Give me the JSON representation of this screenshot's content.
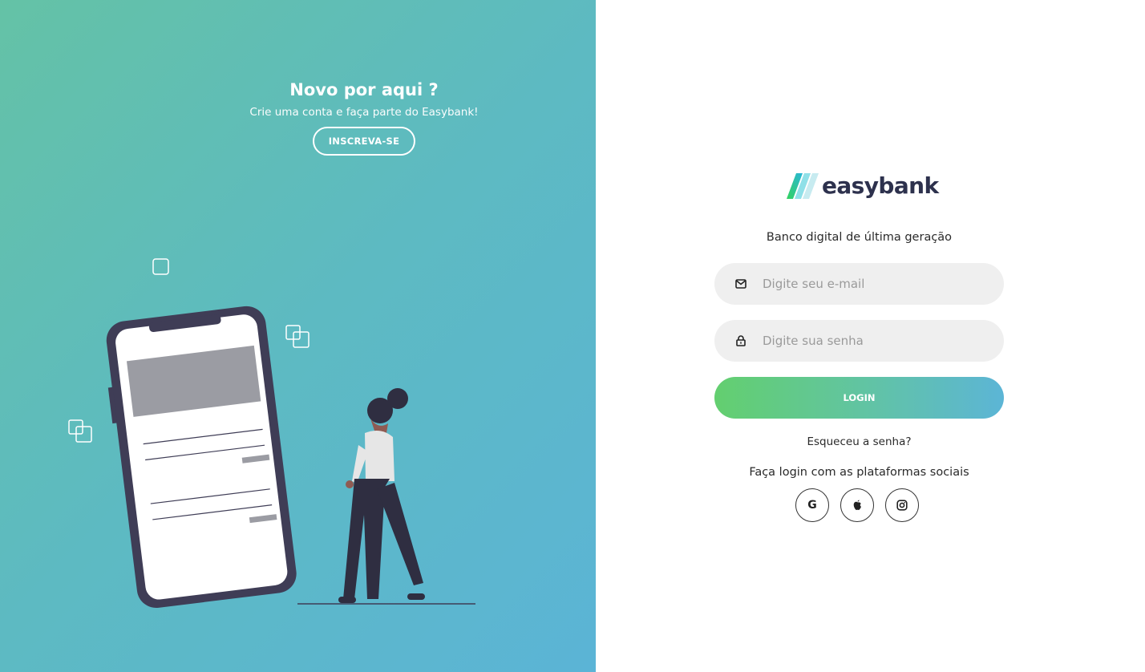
{
  "signup": {
    "title": "Novo por aqui ?",
    "subtitle": "Crie uma conta e faça parte do Easybank!",
    "button_label": "INSCREVA-SE"
  },
  "brand": {
    "name": "easybank",
    "tagline": "Banco digital de última geração"
  },
  "login_form": {
    "email_placeholder": "Digite seu e-mail",
    "email_icon": "envelope-icon",
    "password_placeholder": "Digite sua senha",
    "password_icon": "lock-icon",
    "login_label": "LOGIN",
    "forgot_label": "Esqueceu a senha?"
  },
  "social": {
    "label": "Faça login com as plataformas sociais",
    "providers": [
      {
        "name": "google-icon",
        "glyph": "G"
      },
      {
        "name": "apple-icon",
        "glyph": ""
      },
      {
        "name": "instagram-icon",
        "glyph": ""
      }
    ]
  },
  "colors": {
    "gradient_start": "#64c2a6",
    "gradient_end": "#5bb4d6",
    "login_green": "#63cf6f",
    "brand_dark": "#2d314d",
    "field_bg": "#efefef"
  }
}
